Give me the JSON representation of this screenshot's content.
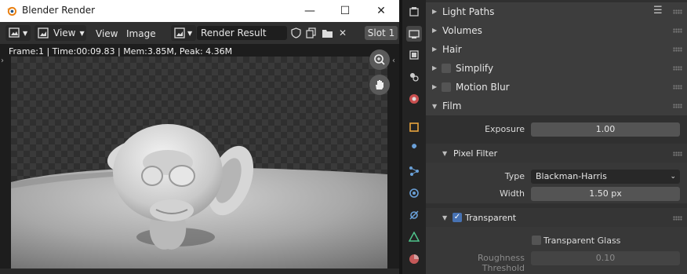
{
  "window": {
    "title": "Blender Render",
    "minimize_glyph": "—",
    "maximize_glyph": "☐",
    "close_glyph": "✕"
  },
  "image_header": {
    "view_menu_button": "View",
    "menus": [
      "View",
      "Image"
    ],
    "image_name": "Render Result",
    "slot": "Slot 1"
  },
  "viewport": {
    "info": "Frame:1 | Time:00:09.83 | Mem:3.85M, Peak: 4.36M"
  },
  "properties": {
    "panels": {
      "light_paths": "Light Paths",
      "volumes": "Volumes",
      "hair": "Hair",
      "simplify": "Simplify",
      "motion_blur": "Motion Blur",
      "film": "Film"
    },
    "film": {
      "exposure_label": "Exposure",
      "exposure_value": "1.00",
      "pixel_filter_label": "Pixel Filter",
      "type_label": "Type",
      "type_value": "Blackman-Harris",
      "width_label": "Width",
      "width_value": "1.50 px",
      "transparent_label": "Transparent",
      "transparent_checked": true,
      "transparent_glass_label": "Transparent Glass",
      "transparent_glass_checked": false,
      "roughness_label": "Roughness Threshold",
      "roughness_value": "0.10"
    }
  },
  "colors": {
    "accent": "#4772b3",
    "header_bg": "#303030",
    "panel_bg": "#3d3d3d"
  }
}
